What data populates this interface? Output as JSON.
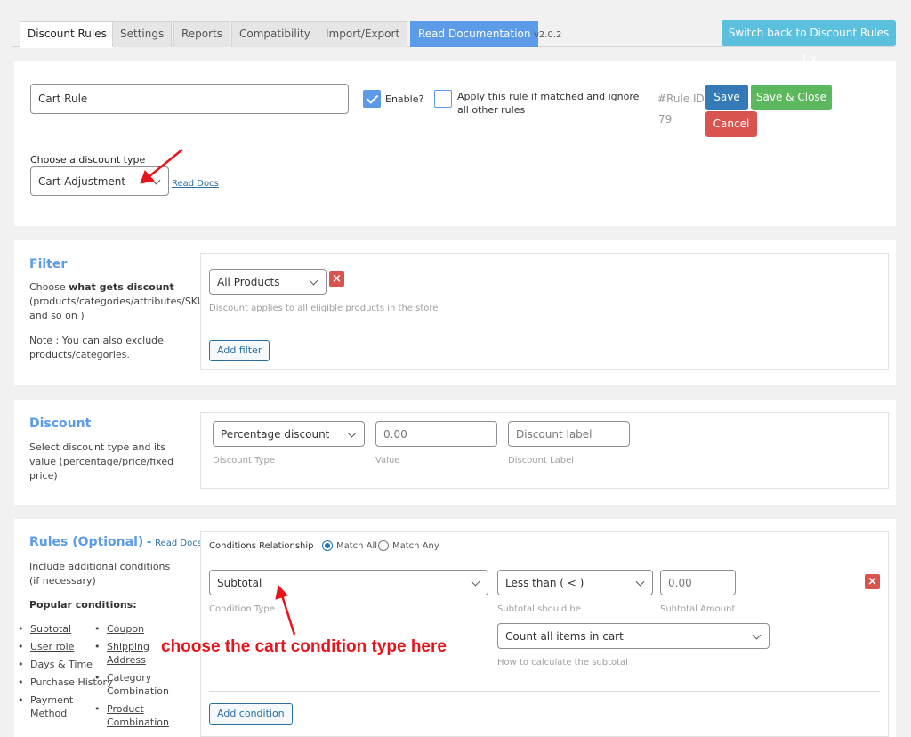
{
  "tabs": [
    {
      "label": "Discount Rules",
      "active": true
    },
    {
      "label": "Settings",
      "active": false
    },
    {
      "label": "Reports",
      "active": false
    },
    {
      "label": "Compatibility",
      "active": false
    },
    {
      "label": "Import/Export",
      "active": false
    },
    {
      "label": "Read Documentation",
      "active": false
    }
  ],
  "version": "v2.0.2",
  "switch_back_label": "Switch back to Discount Rules 1.x",
  "rule": {
    "name_value": "Cart Rule",
    "enable_label": "Enable?",
    "enable_checked": true,
    "exclusive_label": "Apply this rule if matched and ignore all other rules",
    "exclusive_checked": false,
    "rule_id_label": "#Rule ID:",
    "rule_id_value": "79",
    "save_label": "Save",
    "save_close_label": "Save & Close",
    "cancel_label": "Cancel",
    "discount_type_label": "Choose a discount type",
    "discount_type_value": "Cart Adjustment",
    "read_docs_label": "Read Docs"
  },
  "filter": {
    "title": "Filter",
    "desc_prefix": "Choose ",
    "desc_bold": "what gets discount",
    "desc_rest": "(products/categories/attributes/SKU and so on )",
    "note": "Note : You can also exclude products/categories.",
    "select_value": "All Products",
    "hint": "Discount applies to all eligible products in the store",
    "add_label": "Add filter"
  },
  "discount": {
    "title": "Discount",
    "desc": "Select discount type and its value (percentage/price/fixed price)",
    "type_value": "Percentage discount",
    "type_hint": "Discount Type",
    "value_value": "0.00",
    "value_hint": "Value",
    "label_placeholder": "Discount label",
    "label_hint": "Discount Label"
  },
  "rules": {
    "title": "Rules (Optional)",
    "dash": "-",
    "read_docs_label": "Read Docs",
    "desc": "Include additional conditions (if necessary)",
    "popular_label": "Popular conditions:",
    "popular_left": [
      {
        "label": "Subtotal",
        "link": true
      },
      {
        "label": "User role",
        "link": true
      },
      {
        "label": "Days & Time",
        "link": false
      },
      {
        "label": "Purchase History",
        "link": false
      },
      {
        "label": "Payment Method",
        "link": false
      }
    ],
    "popular_right": [
      {
        "label": "Coupon",
        "link": true
      },
      {
        "label": "Shipping Address",
        "link": true
      },
      {
        "label": "Category Combination",
        "link": false
      },
      {
        "label": "Product Combination",
        "link": true
      }
    ],
    "relationship_label": "Conditions Relationship",
    "match_all_label": "Match All",
    "match_any_label": "Match Any",
    "relationship_selected": "Match All",
    "condition_type_value": "Subtotal",
    "condition_type_hint": "Condition Type",
    "operator_value": "Less than ( < )",
    "operator_hint": "Subtotal should be",
    "amount_value": "0.00",
    "amount_hint": "Subtotal Amount",
    "calc_value": "Count all items in cart",
    "calc_hint": "How to calculate the subtotal",
    "add_condition_label": "Add condition"
  },
  "annotation": {
    "text": "choose the cart condition type here",
    "color": "#e8141b"
  },
  "colors": {
    "accent": "#5b9be8",
    "save": "#337ab7",
    "save_close": "#5cb85c",
    "cancel": "#d9534f",
    "switch_back": "#5bc0de"
  }
}
